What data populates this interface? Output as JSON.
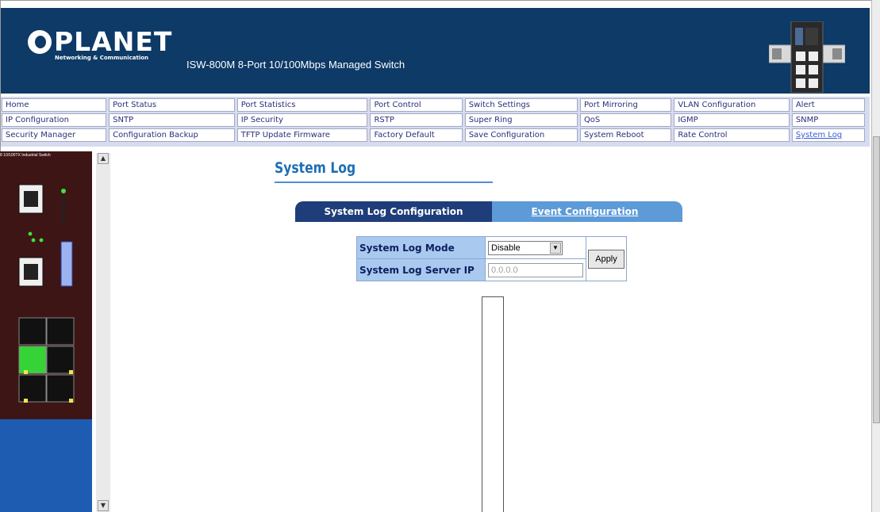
{
  "header": {
    "brand": "PLANET",
    "tagline": "Networking & Communication",
    "product_title": "ISW-800M 8-Port 10/100Mbps Managed Switch"
  },
  "nav": {
    "rows": [
      [
        "Home",
        "Port Status",
        "Port Statistics",
        "Port Control",
        "Switch Settings",
        "Port Mirroring",
        "VLAN Configuration",
        "Alert"
      ],
      [
        "IP Configuration",
        "SNTP",
        "IP Security",
        "RSTP",
        "Super Ring",
        "QoS",
        "IGMP",
        "SNMP"
      ],
      [
        "Security Manager",
        "Configuration Backup",
        "TFTP Update Firmware",
        "Factory Default",
        "Save Configuration",
        "System Reboot",
        "Rate Control",
        "System Log"
      ]
    ],
    "active": "System Log"
  },
  "side_panel": {
    "model_text": "8 10/100TX Industrial Switch"
  },
  "page": {
    "title": "System Log",
    "tabs": [
      {
        "label": "System Log Configuration",
        "active": true
      },
      {
        "label": "Event Configuration",
        "active": false
      }
    ],
    "form": {
      "mode_label": "System Log Mode",
      "mode_value": "Disable",
      "server_ip_label": "System Log Server IP",
      "server_ip_value": "0.0.0.0",
      "apply_label": "Apply"
    }
  },
  "colors": {
    "header_bg": "#0d3a67",
    "nav_bg": "#d6dbef",
    "title": "#1d6fb4",
    "tab_active": "#1e3d7a",
    "tab_inactive": "#5c9ad8",
    "form_label_bg": "#a9c9ef"
  }
}
